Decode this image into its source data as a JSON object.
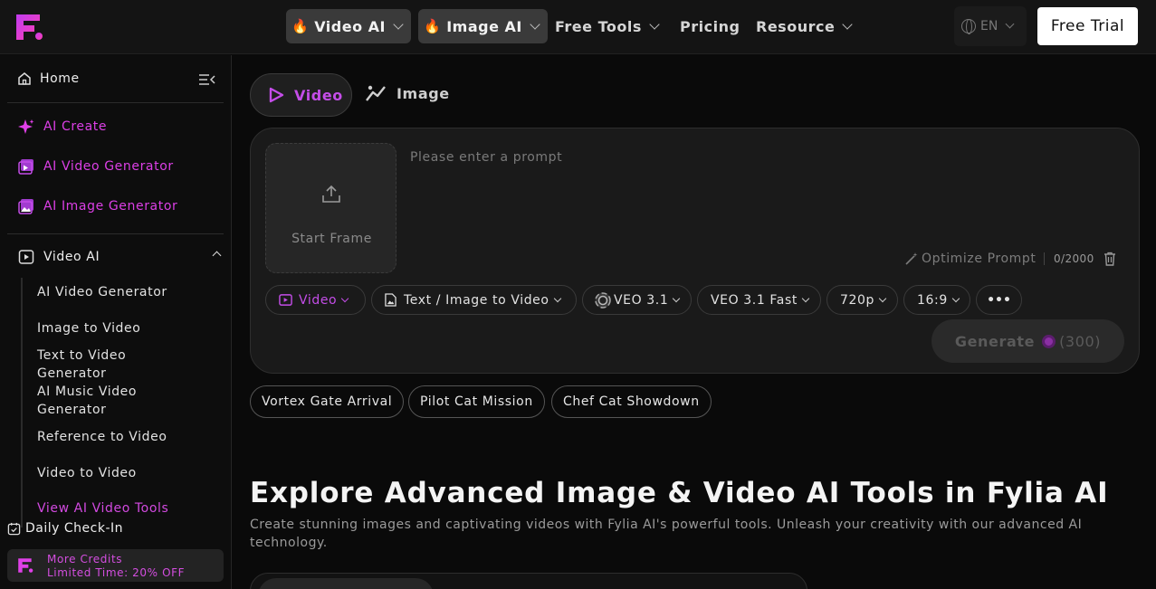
{
  "colors": {
    "accent": "#d040e0",
    "brand_purple": "#c44de8",
    "background": "#0a0a0a",
    "panel": "#1a1a1a"
  },
  "header": {
    "nav": [
      {
        "label": "Video AI",
        "icon": "flame-icon",
        "highlighted": true
      },
      {
        "label": "Image AI",
        "icon": "flame-icon",
        "highlighted": true
      },
      {
        "label": "Free Tools"
      },
      {
        "label": "Pricing"
      },
      {
        "label": "Resource"
      }
    ],
    "language": "EN",
    "free_trial": "Free Trial"
  },
  "sidebar": {
    "home": "Home",
    "main_items": [
      {
        "label": "AI Create",
        "icon": "sparkle-icon"
      },
      {
        "label": "AI Video Generator",
        "icon": "video-icon"
      },
      {
        "label": "AI Image Generator",
        "icon": "image-icon"
      }
    ],
    "section": {
      "label": "Video AI",
      "icon": "play-icon"
    },
    "sub_items": [
      "AI Video Generator",
      "Image to Video",
      "Text to Video Generator",
      "AI Music Video Generator",
      "Reference to Video",
      "Video to Video"
    ],
    "view_all": "View AI Video Tools",
    "daily_checkin": "Daily Check-In",
    "promo": {
      "line1": "More Credits",
      "line2": "Limited Time: 20% OFF"
    }
  },
  "main": {
    "tabs": [
      {
        "label": "Video",
        "active": true
      },
      {
        "label": "Image",
        "active": false
      }
    ],
    "start_frame": "Start Frame",
    "prompt_placeholder": "Please enter a prompt",
    "optimize": "Optimize Prompt",
    "counter": "0/2000",
    "options": [
      {
        "label": "Video",
        "icon": "video-icon"
      },
      {
        "label": "Text / Image to Video",
        "icon": "file-image-icon"
      },
      {
        "label": "VEO 3.1",
        "icon": "veo-logo-icon"
      },
      {
        "label": "VEO 3.1 Fast"
      },
      {
        "label": "720p"
      },
      {
        "label": "16:9"
      }
    ],
    "more": "•••",
    "generate": {
      "label": "Generate",
      "cost": "(300)"
    },
    "suggestions": [
      "Vortex Gate Arrival",
      "Pilot Cat Mission",
      "Chef Cat Showdown"
    ],
    "headline": "Explore Advanced Image & Video AI Tools in Fylia AI",
    "subline": "Create stunning images and captivating videos with Fylia AI's powerful tools. Unleash your creativity with our advanced AI technology."
  }
}
